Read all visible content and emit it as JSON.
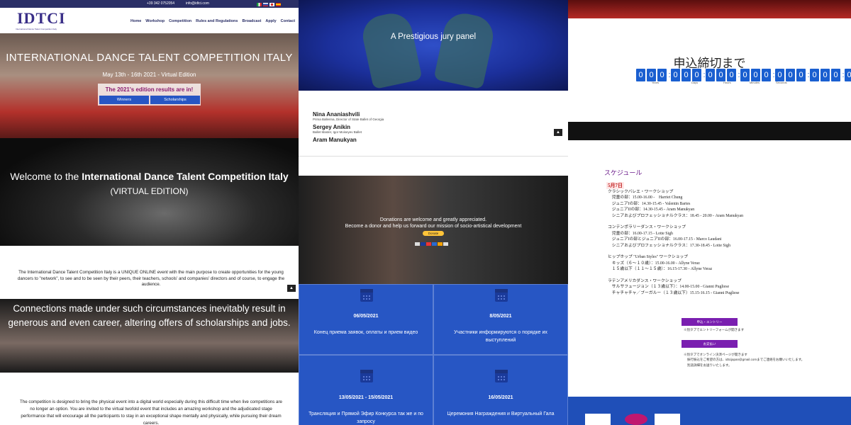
{
  "p1": {
    "phone": "+39 342 0752054",
    "email": "info@idtci.com",
    "flags": [
      "#d42",
      "#fff",
      "#e33",
      "#c60"
    ],
    "logo_text": "IDTCI",
    "logo_sub": "International Dance Talent Competition Italy",
    "nav": [
      "Home",
      "Workshop",
      "Competition",
      "Rules and Regulations",
      "Broadcast",
      "Apply",
      "Contact"
    ],
    "hero_title": "INTERNATIONAL DANCE TALENT COMPETITION ITALY",
    "hero_dates": "May 13th - 16th 2021 - Virtual Edition",
    "results_text": "The 2021's edition results are in!",
    "btn_winners": "Winners",
    "btn_scholarships": "Scholarships",
    "welcome_pre": "Welcome to the ",
    "welcome_bold": "International Dance Talent Competition Italy",
    "welcome_sub": "(VIRTUAL EDITION)",
    "intro": "The International Dance Talent Competition Italy is a UNIQUE ONLINE event with the main purpose to create opportunities for the young dancers to \"network\", to see and to be seen by their peers, their teachers, schools' and companies' directors and of course, to engage the audience.",
    "connections": "Connections made under such circumstances inevitably result in generous and even career, altering offers of scholarships and jobs.",
    "bottom": "The competition is designed to bring the physical event into a digital world especially during this difficult time when live competitions are no longer an option. You are invited to the virtual twofold event that includes an amazing workshop and the adjudicated stage performance that will encourage all the participants to stay in an exceptional shape mentally and physically, while pursuing their dream careers."
  },
  "p2": {
    "jury_title": "A Prestigious jury panel",
    "members": [
      {
        "name": "Nina Ananiashvili",
        "desc": "Prima Ballerina, Director of State Ballet of Georgia"
      },
      {
        "name": "Sergey Anikin",
        "desc": "Ballet Master, Igor Moiseyev Ballet"
      },
      {
        "name": "Aram Manukyan",
        "desc": ""
      }
    ],
    "donation1": "Donations are welcome and greatly appreciated.",
    "donation2": "Become a donor and help us forward our mission of socio-artistical development",
    "donate_btn": "Donate",
    "tiles": [
      {
        "date": "06/05/2021",
        "text": "Конец приема заявок, оплаты и прием видео"
      },
      {
        "date": "8/05/2021",
        "text": "Участники информируются о порядке их выступлений"
      },
      {
        "date": "13/05/2021 - 15/05/2021",
        "text": "Трансляция и Прямой Эфир Конкурса так же и по запросу"
      },
      {
        "date": "16/05/2021",
        "text": "Церемония Награждения и Виртуальный Гала"
      }
    ]
  },
  "p3": {
    "countdown_title": "申込締切まで",
    "countdown": "000:000:000:000:000:000:0",
    "labels": [
      "Years",
      "Days",
      "Hours",
      "Minutes",
      "Seconds"
    ],
    "schedule_title": "スケジュール",
    "day": "5月7日",
    "lines": [
      "クラシックバレエ・ワークショップ",
      "　児童の部：15.00-16.00 -　Harriet Chung",
      "　ジュニアIの部：14.30-15.45 - Valentin Bartes",
      "　ジュニアIIの部：14.30-15.45 - Aram Manukyan",
      "　シニアおよびプロフェッショナルクラス：18.45 - 20.00 - Aram Manukyan",
      "",
      "コンテンポラリーダンス・ワークショップ",
      "　児童の部：16.00-17.15 - Lotte Sigh",
      "　ジュニアIの部とジュニアIIの部：16.00-17.15 - Marco Laudani",
      "　シニアおよびプロフェッショナルクラス：17.30-18.45 - Lotte Sigh",
      "",
      "ヒップホップ \"Urban Styles\" ワークショップ",
      "　キッズ（６～１０歳）：15.00-16.00 - Allyne Veraz",
      "　１５歳以下（１１～１５歳）：16.15-17.30 - Allyne Veraz",
      "",
      "ラテンアメリカダンス・ワークショップ",
      "　サルサフュージョン（１３歳以下）：14.00-15.00 - Gianni Pugliese",
      "　チャチャチャ／ブーガルー（１３歳以下）15.15-16.15 - Gianni Pugliese"
    ],
    "btn_apply": "申込・エントリー",
    "note_apply": "※別タブでエントリーフォームが開きます",
    "btn_pay": "お支払い",
    "note_pay1": "※別タブでオンライン決済ページが開きます",
    "note_pay2": "振行振込をご希望の方は、idtcijapan@gmail.comまでご連絡をお願いいたします。",
    "note_pay3": "別途詳細をお送りいたします。"
  }
}
